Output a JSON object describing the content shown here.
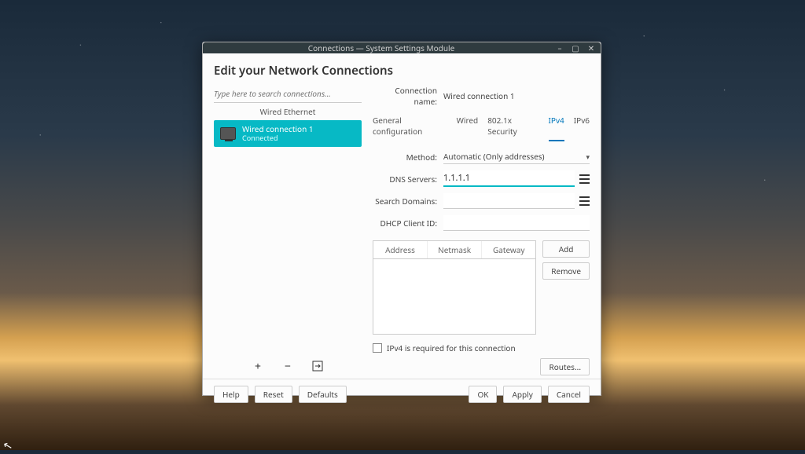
{
  "window": {
    "title": "Connections — System Settings Module"
  },
  "heading": "Edit your Network Connections",
  "search": {
    "placeholder": "Type here to search connections..."
  },
  "sidebar": {
    "section": "Wired Ethernet",
    "items": [
      {
        "name": "Wired connection 1",
        "status": "Connected"
      }
    ]
  },
  "toolbar": {
    "add": "+",
    "remove": "−",
    "export_tip": "Export"
  },
  "detail": {
    "name_label": "Connection name:",
    "name_value": "Wired connection 1",
    "tabs": [
      "General configuration",
      "Wired",
      "802.1x Security",
      "IPv4",
      "IPv6"
    ],
    "active_tab": "IPv4",
    "method_label": "Method:",
    "method_value": "Automatic (Only addresses)",
    "dns_label": "DNS Servers:",
    "dns_value": "1.1.1.1",
    "search_label": "Search Domains:",
    "search_value": "",
    "dhcp_label": "DHCP Client ID:",
    "dhcp_value": "",
    "table_headers": [
      "Address",
      "Netmask",
      "Gateway"
    ],
    "add_btn": "Add",
    "remove_btn": "Remove",
    "required_label": "IPv4 is required for this connection",
    "routes_btn": "Routes..."
  },
  "footer": {
    "help": "Help",
    "reset": "Reset",
    "defaults": "Defaults",
    "ok": "OK",
    "apply": "Apply",
    "cancel": "Cancel"
  }
}
